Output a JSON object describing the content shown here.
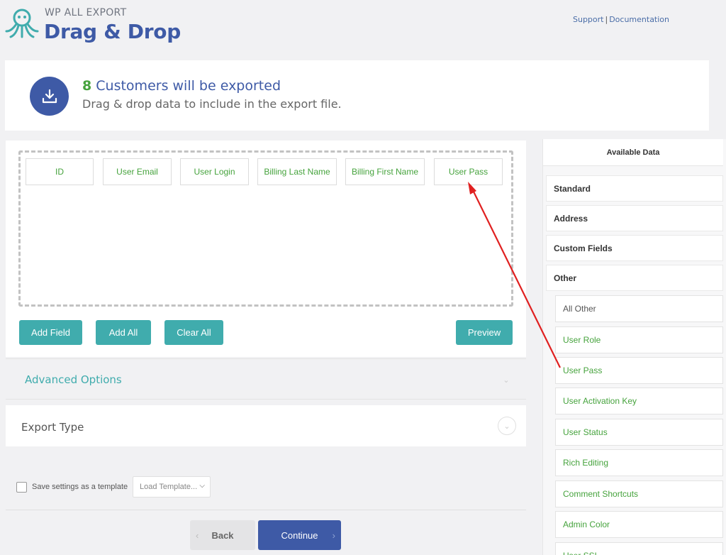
{
  "header": {
    "brand_small": "WP ALL EXPORT",
    "brand_big": "Drag & Drop",
    "links": [
      "Support",
      "Documentation"
    ],
    "link_separator": "|"
  },
  "summary": {
    "count": "8",
    "title_rest": " Customers will be exported",
    "subtitle": "Drag & drop data to include in the export file.",
    "icon": "download-icon"
  },
  "dropzone": {
    "fields": [
      "ID",
      "User Email",
      "User Login",
      "Billing Last Name",
      "Billing First Name",
      "User Pass"
    ]
  },
  "buttons": {
    "add_field": "Add Field",
    "add_all": "Add All",
    "clear_all": "Clear All",
    "preview": "Preview"
  },
  "sections": {
    "advanced_options": "Advanced Options",
    "export_type": "Export Type"
  },
  "bottom": {
    "save_template_label": "Save settings as a template",
    "load_template": "Load Template...",
    "back": "Back",
    "continue": "Continue"
  },
  "sidebar": {
    "title": "Available Data",
    "sections": [
      "Standard",
      "Address",
      "Custom Fields",
      "Other"
    ],
    "other_items": [
      "All Other",
      "User Role",
      "User Pass",
      "User Activation Key",
      "User Status",
      "Rich Editing",
      "Comment Shortcuts",
      "Admin Color",
      "User SSL"
    ]
  },
  "colors": {
    "brand_blue": "#3e5aa6",
    "teal": "#40acad",
    "green": "#46a33d",
    "annotation_red": "#e02020"
  }
}
